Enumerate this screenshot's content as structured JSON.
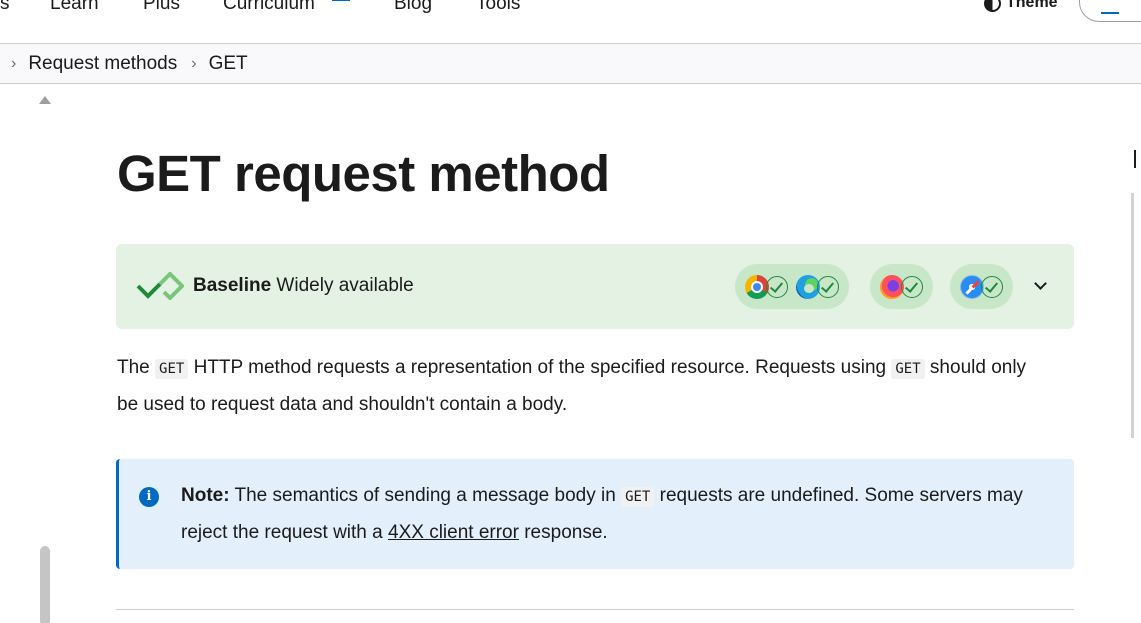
{
  "nav": {
    "items": [
      {
        "label": "s"
      },
      {
        "label": "Learn"
      },
      {
        "label": "Plus"
      },
      {
        "label": "Curriculum"
      },
      {
        "label": "Blog"
      },
      {
        "label": "Tools"
      }
    ],
    "theme_label": "Theme"
  },
  "breadcrumb": [
    "Request methods",
    "GET"
  ],
  "title": "GET request method",
  "baseline": {
    "label_bold": "Baseline",
    "label_rest": " Widely available",
    "browsers": [
      "chrome-icon",
      "edge-icon",
      "firefox-icon",
      "safari-icon"
    ],
    "color": "#e3f2e3",
    "check_color": "#1e8a3c"
  },
  "intro": {
    "p1": "The ",
    "code1": "GET",
    "p2": " HTTP method requests a representation of the specified resource. Requests using ",
    "code2": "GET",
    "p3": " should only be used to request data and shouldn't contain a body."
  },
  "note": {
    "label": "Note:",
    "t1": " The semantics of sending a message body in ",
    "code": "GET",
    "t2": " requests are undefined. Some servers may reject the request with a ",
    "link": "4XX client error",
    "t3": " response.",
    "accent": "#0069c2"
  }
}
